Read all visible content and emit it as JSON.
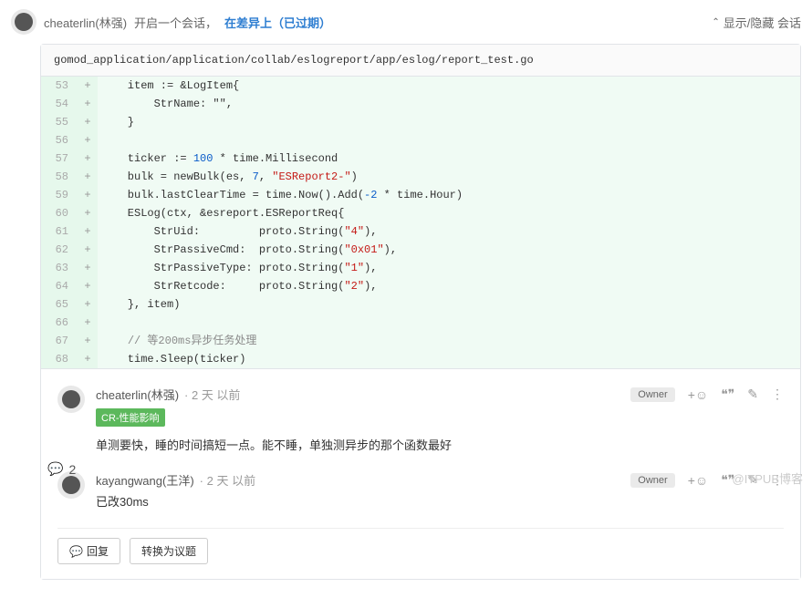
{
  "header": {
    "author": "cheaterlin(林强)",
    "action": "开启一个会话，",
    "link": "在差异上（已过期）",
    "toggle": "显示/隐藏 会话"
  },
  "file_path": "gomod_application/application/collab/eslogreport/app/eslog/report_test.go",
  "diff": [
    {
      "n": "53",
      "c": "    item := &LogItem{"
    },
    {
      "n": "54",
      "c": "        StrName: \"\","
    },
    {
      "n": "55",
      "c": "    }"
    },
    {
      "n": "56",
      "c": ""
    },
    {
      "n": "57",
      "c": "    ticker := 100 * time.Millisecond",
      "hl": [
        [
          "100",
          "num"
        ]
      ]
    },
    {
      "n": "58",
      "c": "    bulk = newBulk(es, 7, \"ESReport2-\")",
      "hl": [
        [
          "7",
          "num"
        ],
        [
          "\"ESReport2-\"",
          "str"
        ]
      ]
    },
    {
      "n": "59",
      "c": "    bulk.lastClearTime = time.Now().Add(-2 * time.Hour)",
      "hl": [
        [
          "-2",
          "num"
        ]
      ]
    },
    {
      "n": "60",
      "c": "    ESLog(ctx, &esreport.ESReportReq{"
    },
    {
      "n": "61",
      "c": "        StrUid:         proto.String(\"4\"),",
      "hl": [
        [
          "\"4\"",
          "str"
        ]
      ]
    },
    {
      "n": "62",
      "c": "        StrPassiveCmd:  proto.String(\"0x01\"),",
      "hl": [
        [
          "\"0x01\"",
          "str"
        ]
      ]
    },
    {
      "n": "63",
      "c": "        StrPassiveType: proto.String(\"1\"),",
      "hl": [
        [
          "\"1\"",
          "str"
        ]
      ]
    },
    {
      "n": "64",
      "c": "        StrRetcode:     proto.String(\"2\"),",
      "hl": [
        [
          "\"2\"",
          "str"
        ]
      ]
    },
    {
      "n": "65",
      "c": "    }, item)"
    },
    {
      "n": "66",
      "c": ""
    },
    {
      "n": "67",
      "c": "    // 等200ms异步任务处理",
      "hl": [
        [
          "// 等200ms异步任务处理",
          "cmt"
        ]
      ]
    },
    {
      "n": "68",
      "c": "    time.Sleep(ticker)"
    }
  ],
  "reply_count": "2",
  "comments": [
    {
      "name": "cheaterlin(林强)",
      "time": "· 2 天 以前",
      "owner": "Owner",
      "tag": "CR-性能影响",
      "text": "单测要快，睡的时间搞短一点。能不睡，单独测异步的那个函数最好"
    },
    {
      "name": "kayangwang(王洋)",
      "time": "· 2 天 以前",
      "owner": "Owner",
      "text": "已改30ms"
    }
  ],
  "buttons": {
    "reply": "回复",
    "convert": "转换为议题"
  },
  "icons": {
    "emoji": "+☺",
    "quote": "❝❞",
    "edit": "✎",
    "more": "⋮"
  },
  "watermark": "@ITPUB博客"
}
